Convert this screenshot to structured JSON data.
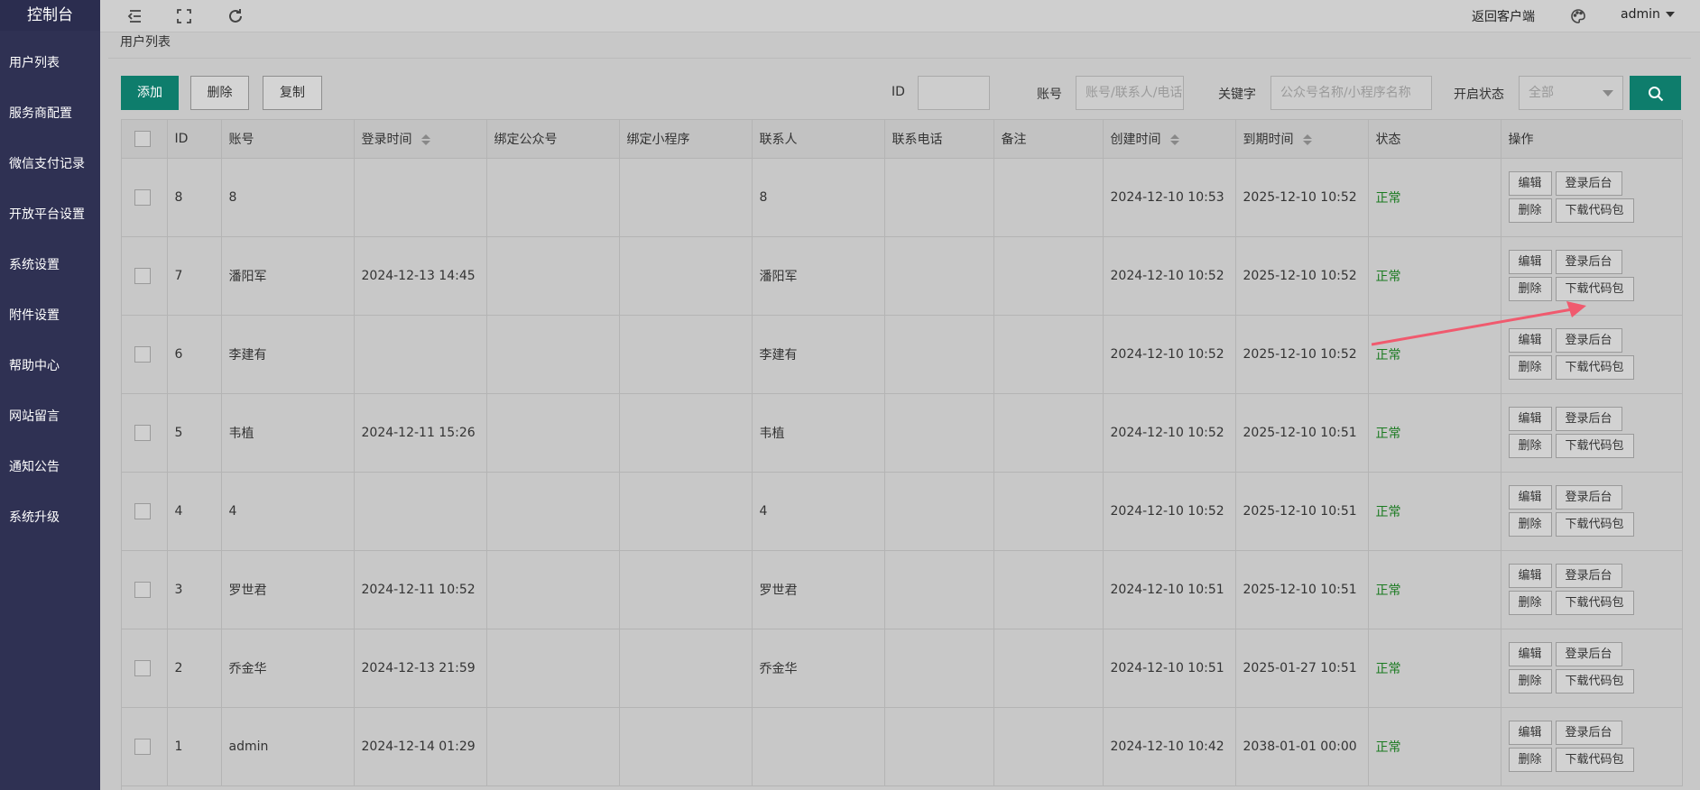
{
  "sidebar": {
    "logo": "控制台",
    "items": [
      {
        "label": "用户列表"
      },
      {
        "label": "服务商配置"
      },
      {
        "label": "微信支付记录"
      },
      {
        "label": "开放平台设置"
      },
      {
        "label": "系统设置"
      },
      {
        "label": "附件设置"
      },
      {
        "label": "帮助中心"
      },
      {
        "label": "网站留言"
      },
      {
        "label": "通知公告"
      },
      {
        "label": "系统升级"
      }
    ]
  },
  "header": {
    "icons": [
      "menu-collapse-icon",
      "fullscreen-icon",
      "refresh-icon",
      "palette-icon"
    ],
    "return_client": "返回客户端",
    "user": "admin"
  },
  "breadcrumb": "用户列表",
  "toolbar": {
    "add": "添加",
    "delete": "删除",
    "copy": "复制"
  },
  "filters": {
    "id_label": "ID",
    "id_value": "",
    "account_label": "账号",
    "account_placeholder": "账号/联系人/电话",
    "keyword_label": "关键字",
    "keyword_placeholder": "公众号名称/小程序名称",
    "status_label": "开启状态",
    "status_selected": "全部",
    "search_icon": "search-icon"
  },
  "table": {
    "columns": [
      "",
      "ID",
      "账号",
      "登录时间",
      "绑定公众号",
      "绑定小程序",
      "联系人",
      "联系电话",
      "备注",
      "创建时间",
      "到期时间",
      "状态",
      "操作"
    ],
    "actions": {
      "edit": "编辑",
      "login": "登录后台",
      "delete": "删除",
      "download": "下载代码包"
    },
    "rows": [
      {
        "id": "8",
        "account": "8",
        "login_time": "",
        "mp": "",
        "miniapp": "",
        "contact": "8",
        "phone": "",
        "note": "",
        "created": "2024-12-10 10:53",
        "expires": "2025-12-10 10:52",
        "status": "正常"
      },
      {
        "id": "7",
        "account": "潘阳军",
        "login_time": "2024-12-13 14:45",
        "mp": "",
        "miniapp": "",
        "contact": "潘阳军",
        "phone": "",
        "note": "",
        "created": "2024-12-10 10:52",
        "expires": "2025-12-10 10:52",
        "status": "正常"
      },
      {
        "id": "6",
        "account": "李建有",
        "login_time": "",
        "mp": "",
        "miniapp": "",
        "contact": "李建有",
        "phone": "",
        "note": "",
        "created": "2024-12-10 10:52",
        "expires": "2025-12-10 10:52",
        "status": "正常"
      },
      {
        "id": "5",
        "account": "韦植",
        "login_time": "2024-12-11 15:26",
        "mp": "",
        "miniapp": "",
        "contact": "韦植",
        "phone": "",
        "note": "",
        "created": "2024-12-10 10:52",
        "expires": "2025-12-10 10:51",
        "status": "正常"
      },
      {
        "id": "4",
        "account": "4",
        "login_time": "",
        "mp": "",
        "miniapp": "",
        "contact": "4",
        "phone": "",
        "note": "",
        "created": "2024-12-10 10:52",
        "expires": "2025-12-10 10:51",
        "status": "正常"
      },
      {
        "id": "3",
        "account": "罗世君",
        "login_time": "2024-12-11 10:52",
        "mp": "",
        "miniapp": "",
        "contact": "罗世君",
        "phone": "",
        "note": "",
        "created": "2024-12-10 10:51",
        "expires": "2025-12-10 10:51",
        "status": "正常"
      },
      {
        "id": "2",
        "account": "乔金华",
        "login_time": "2024-12-13 21:59",
        "mp": "",
        "miniapp": "",
        "contact": "乔金华",
        "phone": "",
        "note": "",
        "created": "2024-12-10 10:51",
        "expires": "2025-01-27 10:51",
        "status": "正常"
      },
      {
        "id": "1",
        "account": "admin",
        "login_time": "2024-12-14 01:29",
        "mp": "",
        "miniapp": "",
        "contact": "",
        "phone": "",
        "note": "",
        "created": "2024-12-10 10:42",
        "expires": "2038-01-01 00:00",
        "status": "正常"
      }
    ]
  },
  "colors": {
    "sidebar_bg": "#2f3153",
    "primary": "#0e7d6c",
    "status_ok": "#1a7a20",
    "annotation_arrow": "#f05a6e"
  }
}
